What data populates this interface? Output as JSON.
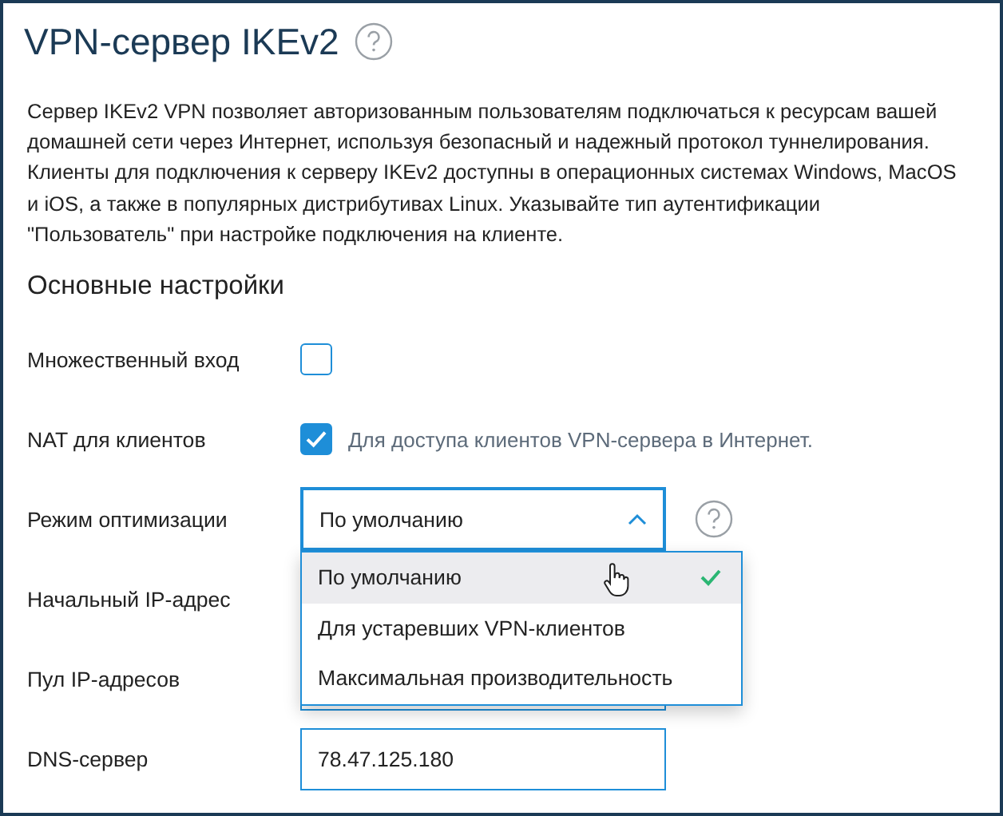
{
  "title": "VPN-сервер IKEv2",
  "description": "Сервер IKEv2 VPN позволяет авторизованным пользователям подключаться к ресурсам вашей домашней сети через Интернет, используя безопасный и надежный протокол туннелирования. Клиенты для подключения к серверу IKEv2 доступны в операционных системах Windows, MacOS и iOS, а также в популярных дистрибутивах Linux. Указывайте тип аутентификации \"Пользователь\" при настройке подключения на клиенте.",
  "section": "Основные настройки",
  "rows": [
    {
      "kind": "checkbox",
      "label": "Множественный вход",
      "checked": false
    },
    {
      "kind": "checkbox",
      "label": "NAT для клиентов",
      "checked": true,
      "hint": "Для доступа клиентов VPN-сервера в Интернет."
    },
    {
      "kind": "select",
      "label": "Режим оптимизации",
      "value": "По умолчанию",
      "expanded": true,
      "options": [
        {
          "label": "По умолчанию",
          "selected": true
        },
        {
          "label": "Для устаревших VPN-клиентов",
          "selected": false
        },
        {
          "label": "Максимальная производительность",
          "selected": false
        }
      ]
    },
    {
      "kind": "label",
      "label": "Начальный IP-адрес"
    },
    {
      "kind": "input",
      "label": "Пул IP-адресов"
    },
    {
      "kind": "input",
      "label": "DNS-сервер",
      "value": "78.47.125.180"
    }
  ]
}
